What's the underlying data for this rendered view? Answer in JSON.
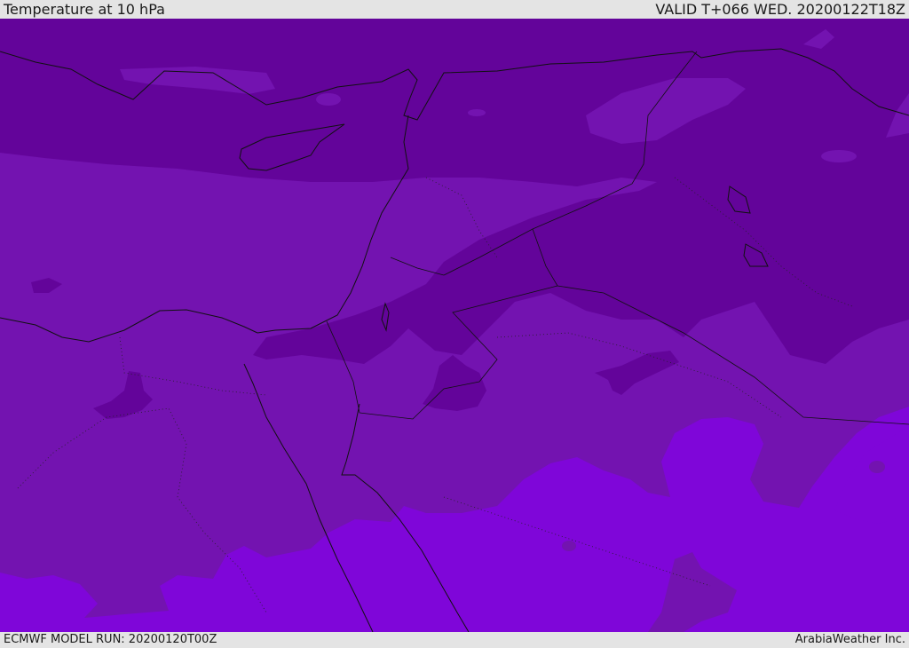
{
  "header": {
    "title": "Temperature at 10 hPa",
    "valid": "VALID T+066 WED. 20200122T18Z"
  },
  "footer": {
    "model_run": "ECMWF MODEL RUN: 20200120T00Z",
    "brand": "ArabiaWeather Inc."
  },
  "colors": {
    "dark_band": "#63049a",
    "mid_band": "#7313b0",
    "light_band": "#7f06d9",
    "coastline": "#111111"
  }
}
